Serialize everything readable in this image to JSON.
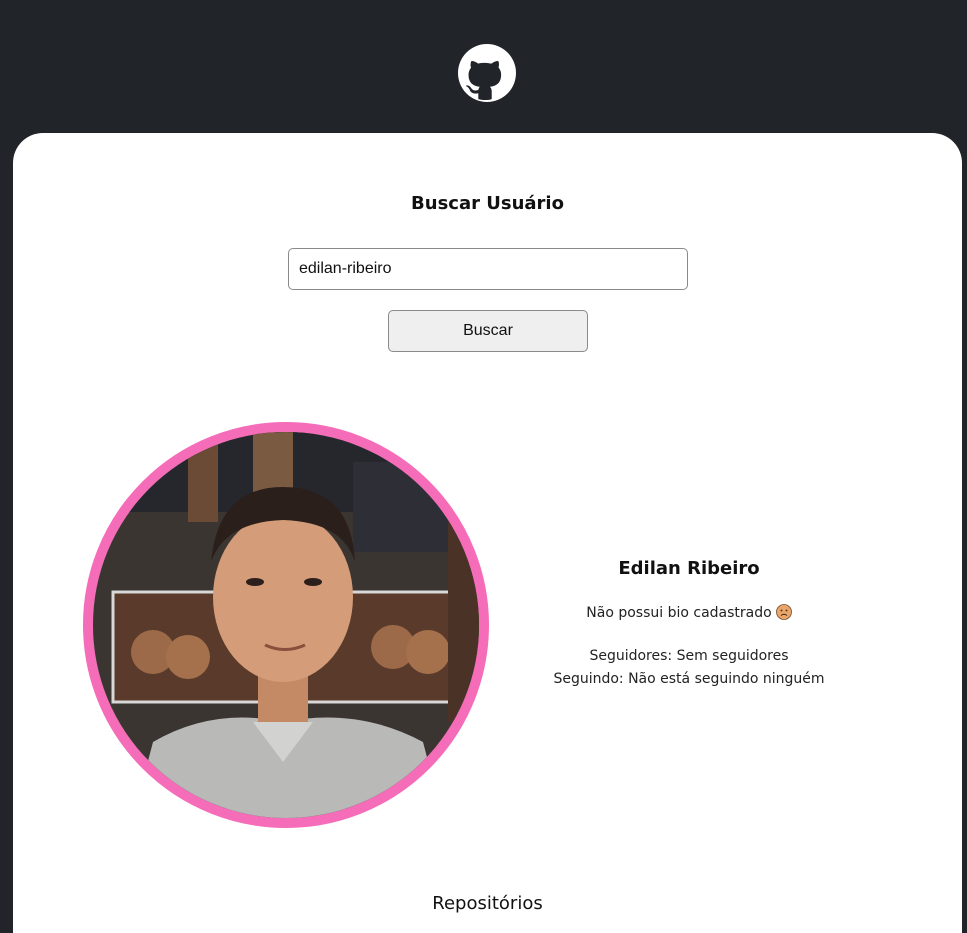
{
  "header": {
    "logo": "github-icon"
  },
  "search": {
    "title": "Buscar Usuário",
    "input_value": "edilan-ribeiro",
    "button_label": "Buscar"
  },
  "profile": {
    "avatar": "profile-photo",
    "name": "Edilan Ribeiro",
    "bio": "Não possui bio cadastrado",
    "bio_icon": "sad-face-emoji-icon",
    "followers": "Seguidores: Sem seguidores",
    "following": "Seguindo: Não está seguindo ninguém"
  },
  "repositories": {
    "title": "Repositórios"
  },
  "colors": {
    "background": "#212529",
    "card": "#ffffff",
    "avatar_border": "#f56cb9"
  }
}
